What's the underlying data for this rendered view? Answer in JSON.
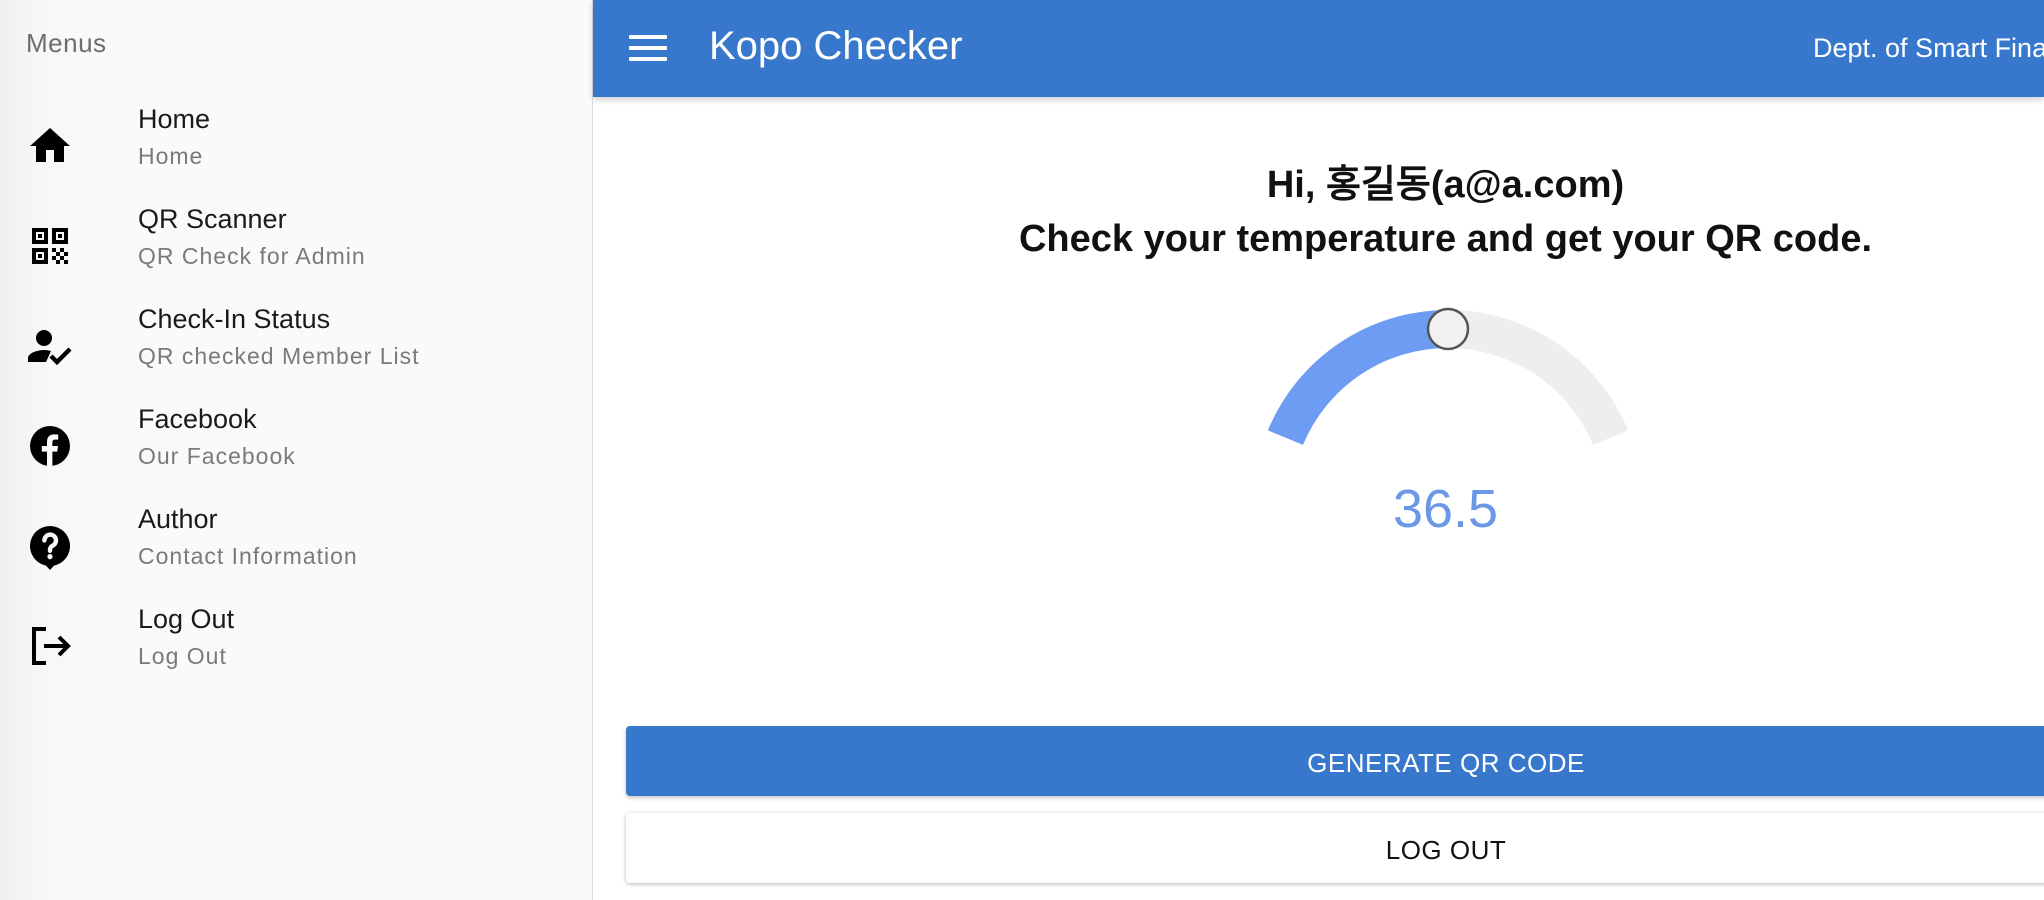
{
  "drawer": {
    "title": "Menus",
    "items": [
      {
        "label": "Home",
        "sublabel": "Home",
        "icon": "home-icon"
      },
      {
        "label": "QR Scanner",
        "sublabel": "QR Check for Admin",
        "icon": "qr-code-icon"
      },
      {
        "label": "Check-In Status",
        "sublabel": "QR checked Member List",
        "icon": "user-check-icon"
      },
      {
        "label": "Facebook",
        "sublabel": "Our Facebook",
        "icon": "facebook-icon"
      },
      {
        "label": "Author",
        "sublabel": "Contact Information",
        "icon": "help-icon"
      },
      {
        "label": "Log Out",
        "sublabel": "Log Out",
        "icon": "logout-icon"
      }
    ]
  },
  "appbar": {
    "title": "Kopo Checker",
    "department": "Dept. of Smart Fina"
  },
  "main": {
    "greeting": "Hi, 홍길동(a@a.com)",
    "instruction": "Check your temperature and get your QR code.",
    "temperature": {
      "value": "36.5",
      "fill_fraction": 0.5
    },
    "primary_button": "GENERATE QR CODE",
    "secondary_button": "LOG OUT"
  },
  "colors": {
    "appbar": "#3778cd",
    "primary_button": "#3778cd",
    "gauge_active": "#6f9cf3",
    "gauge_track": "#eeeeee",
    "gauge_value_text": "#6a97e6",
    "drawer_background": "#fafafa"
  }
}
